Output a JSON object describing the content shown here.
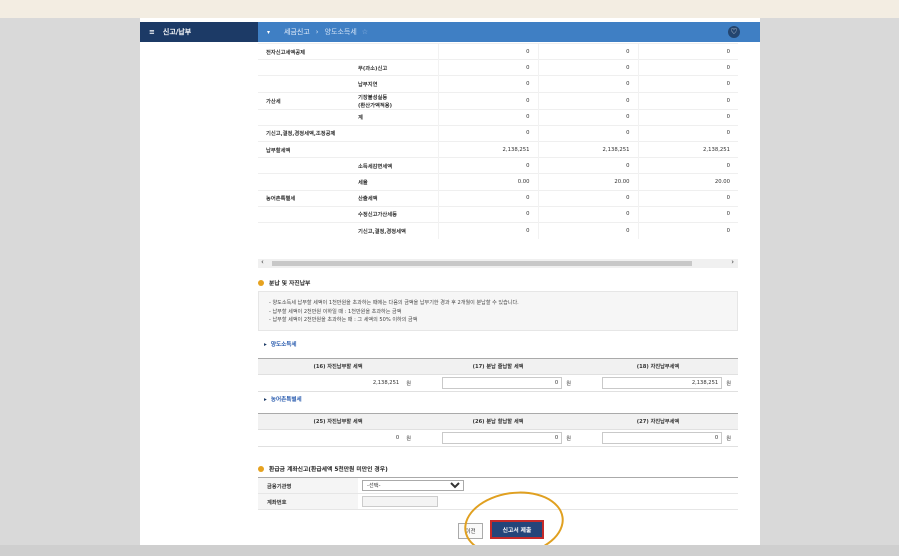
{
  "nav": {
    "home_label": "신고/납부",
    "crumb_1": "세금신고",
    "crumb_2": "양도소득세",
    "dropdown_glyph": "▾",
    "star_glyph": "☆",
    "heart_glyph": "♡"
  },
  "tax_table": {
    "rows": [
      {
        "h1": "전자신고세액공제",
        "h2": "",
        "values": [
          "0",
          "0",
          "0"
        ]
      },
      {
        "h1": "",
        "h2": "무(과소)신고",
        "values": [
          "0",
          "0",
          "0"
        ]
      },
      {
        "h1": "",
        "h2": "납부지연",
        "values": [
          "0",
          "0",
          "0"
        ]
      },
      {
        "h1": "가산세",
        "h2": "기장불성실등",
        "h2_line2": "(환산가액적용)",
        "values": [
          "0",
          "0",
          "0"
        ]
      },
      {
        "h1": "",
        "h2": "계",
        "values": [
          "0",
          "0",
          "0"
        ]
      },
      {
        "h1": "기신고,결정,경정세액,조정공제",
        "h2": "",
        "values": [
          "0",
          "0",
          "0"
        ]
      },
      {
        "h1": "납부할세액",
        "h2": "",
        "values": [
          "2,138,251",
          "2,138,251",
          "2,138,251"
        ]
      },
      {
        "h1": "",
        "h2": "소득세감면세액",
        "values": [
          "0",
          "0",
          "0"
        ]
      },
      {
        "h1": "",
        "h2": "세율",
        "values": [
          "0.00",
          "20.00",
          "20.00"
        ]
      },
      {
        "h1": "농어촌특별세",
        "h2": "산출세액",
        "values": [
          "0",
          "0",
          "0"
        ]
      },
      {
        "h1": "",
        "h2": "수정신고가산세등",
        "values": [
          "0",
          "0",
          "0"
        ]
      },
      {
        "h1": "",
        "h2": "기신고,결정,경정세액",
        "values": [
          "0",
          "0",
          "0"
        ]
      }
    ]
  },
  "installment": {
    "title": "분납 및 자진납부",
    "note_line1": "- 양도소득세 납부할 세액이 1천만원을 초과하는 때에는 다음의 금액을 납부기한 경과 후 2개월이 분납할 수 있습니다.",
    "note_line2": "- 납부할 세액이 2천만원 이하일 때 : 1천만원을 초과하는 금액",
    "note_line3": "- 납부할 세액이 2천만원을 초과하는 때 : 그 세액의 50% 이하의 금액"
  },
  "transfer_tax": {
    "label": "양도소득세",
    "col1": "(16) 자진납부할 세액",
    "col2": "(17) 분납 줄납할 세액",
    "col3": "(18) 자진납부세액",
    "val1": "2,138,251",
    "val2": "0",
    "val3": "2,138,251",
    "unit": "원"
  },
  "rural_tax": {
    "label": "농어촌특별세",
    "col1": "(25) 자진납부할 세액",
    "col2": "(26) 분납 할납할 세액",
    "col3": "(27) 자진납부세액",
    "val1": "0",
    "val2": "0",
    "val3": "0",
    "unit": "원"
  },
  "refund": {
    "title": "환급금 계좌신고(환급세액 5천만원 미만인 경우)",
    "bank_label": "금융기관명",
    "bank_select": "-선택-",
    "account_label": "계좌번호",
    "account_value": ""
  },
  "buttons": {
    "prev": "이전",
    "submit": "신고서 제출"
  },
  "colors": {
    "nav_dark": "#1c3a66",
    "nav_blue": "#3f7fc4",
    "submit_bg": "#24457a",
    "highlight_circle": "#e0a020",
    "section_dot": "#e6a21f"
  }
}
